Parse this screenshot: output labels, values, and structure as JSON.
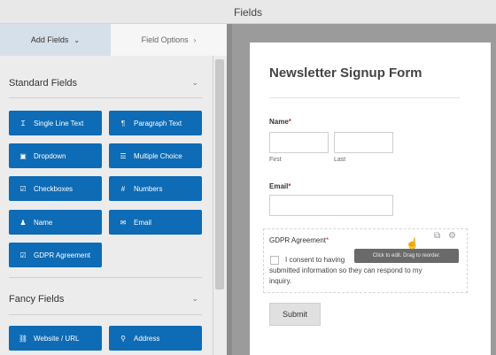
{
  "window": {
    "title": "Fields"
  },
  "tabs": {
    "add_fields": "Add Fields",
    "field_options": "Field Options",
    "add_chevron": "⌄",
    "options_chevron": "›"
  },
  "standard": {
    "title": "Standard Fields",
    "toggle": "⌄",
    "buttons": [
      {
        "label": "Single Line Text",
        "icon": "text-cursor-icon",
        "glyph": "Ɪ"
      },
      {
        "label": "Paragraph Text",
        "icon": "paragraph-icon",
        "glyph": "¶"
      },
      {
        "label": "Dropdown",
        "icon": "dropdown-icon",
        "glyph": "▣"
      },
      {
        "label": "Multiple Choice",
        "icon": "list-icon",
        "glyph": "☰"
      },
      {
        "label": "Checkboxes",
        "icon": "checkbox-icon",
        "glyph": "☑"
      },
      {
        "label": "Numbers",
        "icon": "hash-icon",
        "glyph": "#"
      },
      {
        "label": "Name",
        "icon": "user-icon",
        "glyph": "♟"
      },
      {
        "label": "Email",
        "icon": "envelope-icon",
        "glyph": "✉"
      },
      {
        "label": "GDPR Agreement",
        "icon": "checkbox-icon",
        "glyph": "☑"
      }
    ]
  },
  "fancy": {
    "title": "Fancy Fields",
    "toggle": "⌄",
    "buttons": [
      {
        "label": "Website / URL",
        "icon": "link-icon",
        "glyph": "⛓"
      },
      {
        "label": "Address",
        "icon": "map-pin-icon",
        "glyph": "⚲"
      }
    ]
  },
  "form": {
    "title": "Newsletter Signup Form",
    "name_label": "Name",
    "name_required": "*",
    "first_label": "First",
    "last_label": "Last",
    "email_label": "Email",
    "email_required": "*",
    "gdpr_label": "GDPR Agreement",
    "gdpr_required": "*",
    "consent_line1": "I consent to having",
    "consent_line2": "submitted information so they can respond to my",
    "consent_line3": "inquiry.",
    "tooltip": "Click to edit. Drag to reorder.",
    "duplicate_icon": "⧉",
    "settings_icon": "⚙",
    "cursor_icon": "☝",
    "submit_label": "Submit"
  }
}
